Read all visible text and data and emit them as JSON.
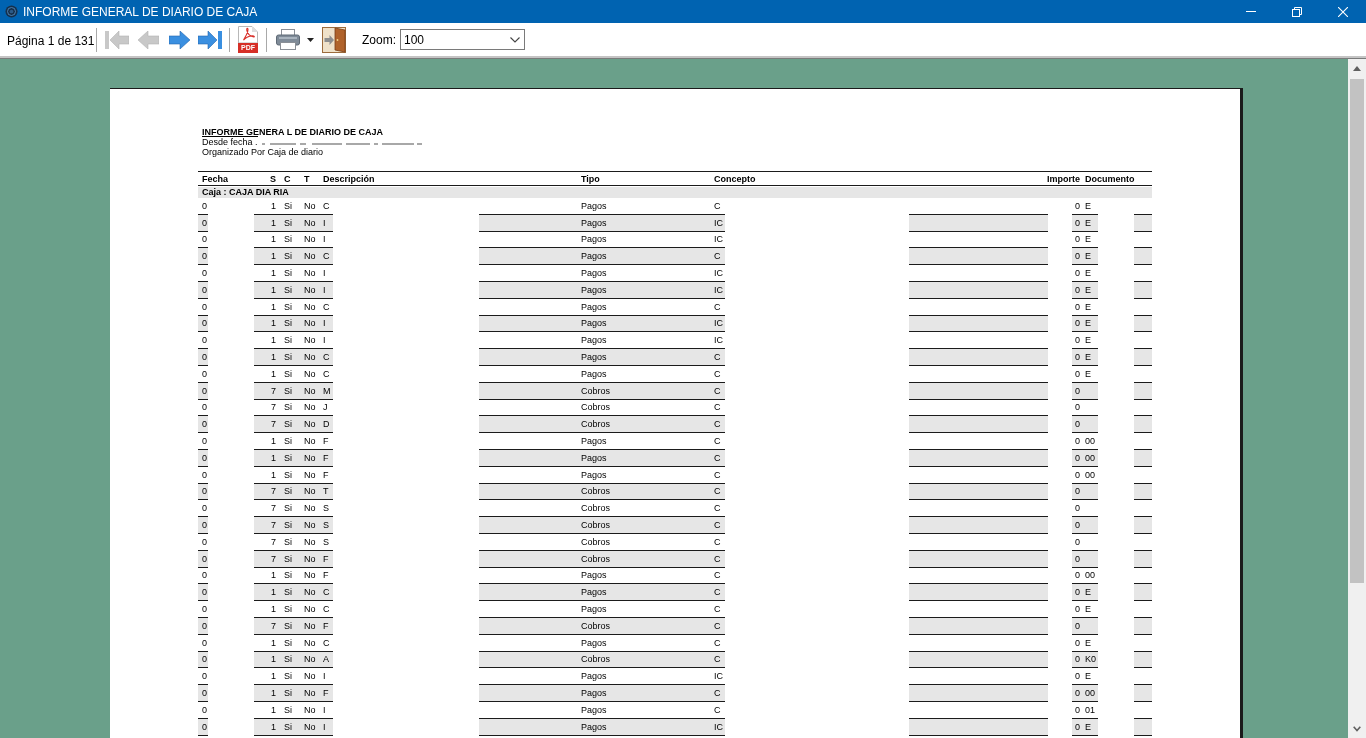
{
  "window": {
    "title": "INFORME GENERAL DE DIARIO DE CAJA"
  },
  "toolbar": {
    "page_indicator": "Página 1 de 131",
    "navigation": [
      {
        "kind": "first",
        "disabled": true
      },
      {
        "kind": "previous",
        "disabled": true
      },
      {
        "kind": "next",
        "disabled": false
      },
      {
        "kind": "last",
        "disabled": false
      }
    ],
    "pdf_label": "PDF",
    "zoom_label": "Zoom:",
    "zoom_value": "100"
  },
  "report": {
    "title": "INFORME GENERA L DE DIARIO DE CAJA",
    "date_range": "Desde fecha .",
    "organized_by": "Organizado Por Caja de diario",
    "columns": [
      "Fecha",
      "S",
      "C",
      "T",
      "Descripción",
      "Tipo",
      "Concepto",
      "Importe",
      "Documento"
    ],
    "group": "Caja : CAJA DIA RIA",
    "rows": [
      {
        "fecha": "0",
        "s": "1",
        "c": "Si",
        "t": "No",
        "descripcion": "C",
        "tipo": "Pagos",
        "concepto": "C",
        "importe": "0",
        "documento": "E"
      },
      {
        "fecha": "0",
        "s": "1",
        "c": "Si",
        "t": "No",
        "descripcion": "I",
        "tipo": "Pagos",
        "concepto": "IC",
        "importe": "0",
        "documento": "E"
      },
      {
        "fecha": "0",
        "s": "1",
        "c": "Si",
        "t": "No",
        "descripcion": "I",
        "tipo": "Pagos",
        "concepto": "IC",
        "importe": "0",
        "documento": "E"
      },
      {
        "fecha": "0",
        "s": "1",
        "c": "Si",
        "t": "No",
        "descripcion": "C",
        "tipo": "Pagos",
        "concepto": "C",
        "importe": "0",
        "documento": "E"
      },
      {
        "fecha": "0",
        "s": "1",
        "c": "Si",
        "t": "No",
        "descripcion": "I",
        "tipo": "Pagos",
        "concepto": "IC",
        "importe": "0",
        "documento": "E"
      },
      {
        "fecha": "0",
        "s": "1",
        "c": "Si",
        "t": "No",
        "descripcion": "I",
        "tipo": "Pagos",
        "concepto": "IC",
        "importe": "0",
        "documento": "E"
      },
      {
        "fecha": "0",
        "s": "1",
        "c": "Si",
        "t": "No",
        "descripcion": "C",
        "tipo": "Pagos",
        "concepto": "C",
        "importe": "0",
        "documento": "E"
      },
      {
        "fecha": "0",
        "s": "1",
        "c": "Si",
        "t": "No",
        "descripcion": "I",
        "tipo": "Pagos",
        "concepto": "IC",
        "importe": "0",
        "documento": "E"
      },
      {
        "fecha": "0",
        "s": "1",
        "c": "Si",
        "t": "No",
        "descripcion": "I",
        "tipo": "Pagos",
        "concepto": "IC",
        "importe": "0",
        "documento": "E"
      },
      {
        "fecha": "0",
        "s": "1",
        "c": "Si",
        "t": "No",
        "descripcion": "C",
        "tipo": "Pagos",
        "concepto": "C",
        "importe": "0",
        "documento": "E"
      },
      {
        "fecha": "0",
        "s": "1",
        "c": "Si",
        "t": "No",
        "descripcion": "C",
        "tipo": "Pagos",
        "concepto": "C",
        "importe": "0",
        "documento": "E"
      },
      {
        "fecha": "0",
        "s": "7",
        "c": "Si",
        "t": "No",
        "descripcion": "M",
        "tipo": "Cobros",
        "concepto": "C",
        "importe": "0"
      },
      {
        "fecha": "0",
        "s": "7",
        "c": "Si",
        "t": "No",
        "descripcion": "J",
        "tipo": "Cobros",
        "concepto": "C",
        "importe": "0"
      },
      {
        "fecha": "0",
        "s": "7",
        "c": "Si",
        "t": "No",
        "descripcion": "D",
        "tipo": "Cobros",
        "concepto": "C",
        "importe": "0"
      },
      {
        "fecha": "0",
        "s": "1",
        "c": "Si",
        "t": "No",
        "descripcion": "F",
        "tipo": "Pagos",
        "concepto": "C",
        "importe": "0",
        "documento": "00"
      },
      {
        "fecha": "0",
        "s": "1",
        "c": "Si",
        "t": "No",
        "descripcion": "F",
        "tipo": "Pagos",
        "concepto": "C",
        "importe": "0",
        "documento": "00"
      },
      {
        "fecha": "0",
        "s": "1",
        "c": "Si",
        "t": "No",
        "descripcion": "F",
        "tipo": "Pagos",
        "concepto": "C",
        "importe": "0",
        "documento": "00"
      },
      {
        "fecha": "0",
        "s": "7",
        "c": "Si",
        "t": "No",
        "descripcion": "T",
        "tipo": "Cobros",
        "concepto": "C",
        "importe": "0"
      },
      {
        "fecha": "0",
        "s": "7",
        "c": "Si",
        "t": "No",
        "descripcion": "S",
        "tipo": "Cobros",
        "concepto": "C",
        "importe": "0"
      },
      {
        "fecha": "0",
        "s": "7",
        "c": "Si",
        "t": "No",
        "descripcion": "S",
        "tipo": "Cobros",
        "concepto": "C",
        "importe": "0"
      },
      {
        "fecha": "0",
        "s": "7",
        "c": "Si",
        "t": "No",
        "descripcion": "S",
        "tipo": "Cobros",
        "concepto": "C",
        "importe": "0"
      },
      {
        "fecha": "0",
        "s": "7",
        "c": "Si",
        "t": "No",
        "descripcion": "F",
        "tipo": "Cobros",
        "concepto": "C",
        "importe": "0"
      },
      {
        "fecha": "0",
        "s": "1",
        "c": "Si",
        "t": "No",
        "descripcion": "F",
        "tipo": "Pagos",
        "concepto": "C",
        "importe": "0",
        "documento": "00"
      },
      {
        "fecha": "0",
        "s": "1",
        "c": "Si",
        "t": "No",
        "descripcion": "C",
        "tipo": "Pagos",
        "concepto": "C",
        "importe": "0",
        "documento": "E"
      },
      {
        "fecha": "0",
        "s": "1",
        "c": "Si",
        "t": "No",
        "descripcion": "C",
        "tipo": "Pagos",
        "concepto": "C",
        "importe": "0",
        "documento": "E"
      },
      {
        "fecha": "0",
        "s": "7",
        "c": "Si",
        "t": "No",
        "descripcion": "F",
        "tipo": "Cobros",
        "concepto": "C",
        "importe": "0"
      },
      {
        "fecha": "0",
        "s": "1",
        "c": "Si",
        "t": "No",
        "descripcion": "C",
        "tipo": "Pagos",
        "concepto": "C",
        "importe": "0",
        "documento": "E"
      },
      {
        "fecha": "0",
        "s": "1",
        "c": "Si",
        "t": "No",
        "descripcion": "A",
        "tipo": "Cobros",
        "concepto": "C",
        "importe": "0",
        "documento": "K0"
      },
      {
        "fecha": "0",
        "s": "1",
        "c": "Si",
        "t": "No",
        "descripcion": "I",
        "tipo": "Pagos",
        "concepto": "IC",
        "importe": "0",
        "documento": "E"
      },
      {
        "fecha": "0",
        "s": "1",
        "c": "Si",
        "t": "No",
        "descripcion": "F",
        "tipo": "Pagos",
        "concepto": "C",
        "importe": "0",
        "documento": "00"
      },
      {
        "fecha": "0",
        "s": "1",
        "c": "Si",
        "t": "No",
        "descripcion": "I",
        "tipo": "Pagos",
        "concepto": "C",
        "importe": "0",
        "documento": "01"
      },
      {
        "fecha": "0",
        "s": "1",
        "c": "Si",
        "t": "No",
        "descripcion": "I",
        "tipo": "Pagos",
        "concepto": "IC",
        "importe": "0",
        "documento": "E"
      }
    ]
  }
}
